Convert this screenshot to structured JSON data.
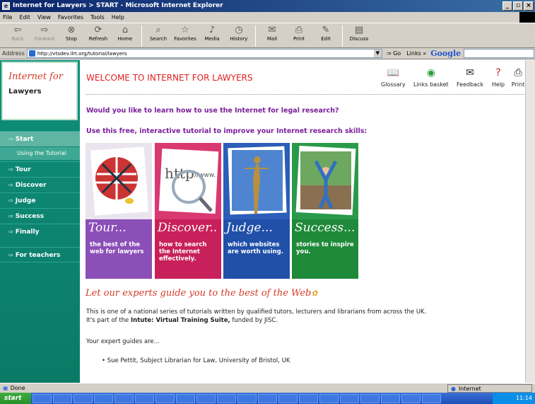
{
  "window": {
    "title": "Internet for Lawyers > START   - Microsoft Internet Explorer",
    "controls": [
      "_",
      "▫",
      "×"
    ]
  },
  "menu": [
    "File",
    "Edit",
    "View",
    "Favorites",
    "Tools",
    "Help"
  ],
  "toolbar": {
    "back": "Back",
    "forward": "Forward",
    "stop": "Stop",
    "refresh": "Refresh",
    "home": "Home",
    "search": "Search",
    "favorites": "Favorites",
    "media": "Media",
    "history": "History",
    "mail": "Mail",
    "print": "Print",
    "edit": "Edit",
    "discuss": "Discuss"
  },
  "address_bar": {
    "label": "Address",
    "url": "http://vtsdev.ilrt.org/tutorial/lawyers",
    "go": "Go",
    "links": "Links",
    "google": "Google"
  },
  "sidebar": {
    "logo_line1": "Internet for",
    "logo_line2": "Lawyers",
    "items": [
      {
        "label": "Start"
      },
      {
        "label": "Using the Tutorial"
      },
      {
        "label": "Tour"
      },
      {
        "label": "Discover"
      },
      {
        "label": "Judge"
      },
      {
        "label": "Success"
      },
      {
        "label": "Finally"
      },
      {
        "label": "For teachers"
      }
    ]
  },
  "header": {
    "title": "WELCOME TO INTERNET FOR LAWYERS",
    "icons": [
      {
        "label": "Glossary",
        "icon": "book-icon"
      },
      {
        "label": "Links basket",
        "icon": "basket-icon"
      },
      {
        "label": "Feedback",
        "icon": "feedback-icon"
      },
      {
        "label": "Help",
        "icon": "help-icon"
      },
      {
        "label": "Print",
        "icon": "printer-icon"
      }
    ]
  },
  "intro": {
    "question": "Would you like to learn how to use the Internet for legal research?",
    "subtitle": "Use this free, interactive tutorial to improve your Internet research skills:"
  },
  "cards": [
    {
      "title": "Tour...",
      "desc": "the best of the web for lawyers",
      "color": "#8b4fb8"
    },
    {
      "title": "Discover..",
      "desc": "how to search the Internet effectively.",
      "color": "#c8205a"
    },
    {
      "title": "Judge...",
      "desc": "which websites are worth using.",
      "color": "#2050a8"
    },
    {
      "title": "Success...",
      "desc": "stories to inspire you.",
      "color": "#1f8a3a"
    }
  ],
  "guide": {
    "title": "Let our experts guide you to the best of the Web",
    "line1": "This is one of a national series of tutorials written by qualified tutors, lecturers and librarians from across the UK.",
    "line2_prefix": "It's part of the ",
    "line2_bold": "Intute: Virtual Training Suite,",
    "line2_suffix": " funded by JISC.",
    "guides_label": "Your expert guides are...",
    "guide_item": "Sue Pettit, Subject Librarian for Law, University of Bristol, UK"
  },
  "status": {
    "text": "Done",
    "zone": "Internet"
  },
  "taskbar": {
    "start": "start",
    "time": "11:14"
  }
}
